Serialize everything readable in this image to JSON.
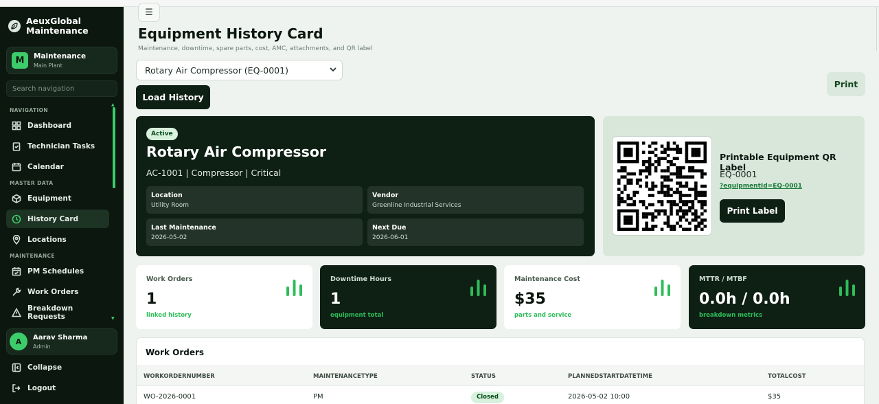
{
  "app": {
    "brand_line1": "AeuxGlobal",
    "brand_line2": "Maintenance",
    "brand_logo_icon": "leaf-icon"
  },
  "workspace": {
    "badge": "M",
    "title": "Maintenance",
    "subtitle": "Main Plant"
  },
  "search": {
    "placeholder": "Search navigation"
  },
  "nav": {
    "section_navigation": "NAVIGATION",
    "section_master": "MASTER DATA",
    "section_maintenance": "MAINTENANCE",
    "items": [
      {
        "label": "Dashboard",
        "icon": "grid-icon"
      },
      {
        "label": "Technician Tasks",
        "icon": "clipboard-icon"
      },
      {
        "label": "Calendar",
        "icon": "calendar-icon"
      },
      {
        "label": "Equipment",
        "icon": "box-icon"
      },
      {
        "label": "History Card",
        "icon": "history-icon"
      },
      {
        "label": "Locations",
        "icon": "pin-icon"
      },
      {
        "label": "PM Schedules",
        "icon": "calendar-check-icon"
      },
      {
        "label": "Work Orders",
        "icon": "wrench-icon"
      },
      {
        "label": "Breakdown Requests",
        "icon": "alert-icon"
      }
    ]
  },
  "user": {
    "initial": "A",
    "name": "Aarav Sharma",
    "role": "Admin"
  },
  "sidebar_bottom": {
    "collapse": "Collapse",
    "logout": "Logout"
  },
  "header": {
    "menu_icon": "☰",
    "title": "Equipment History Card",
    "subtitle": "Maintenance, downtime, spare parts, cost, AMC, attachments, and QR label",
    "print": "Print"
  },
  "selector": {
    "selected": "Rotary Air Compressor (EQ-0001)"
  },
  "load_button": "Load History",
  "equipment": {
    "status": "Active",
    "name": "Rotary Air Compressor",
    "meta": "AC-1001 | Compressor | Critical",
    "location_label": "Location",
    "location": "Utility Room",
    "vendor_label": "Vendor",
    "vendor": "Greenline Industrial Services",
    "last_label": "Last Maintenance",
    "last": "2026-05-02",
    "next_label": "Next Due",
    "next": "2026-06-01"
  },
  "qr": {
    "title": "Printable Equipment QR Label",
    "code": "EQ-0001",
    "link": "?equipmentId=EQ-0001",
    "print": "Print Label"
  },
  "kpis": [
    {
      "label": "Work Orders",
      "value": "1",
      "sub": "linked history",
      "icon": "bar-chart-icon"
    },
    {
      "label": "Downtime Hours",
      "value": "1",
      "sub": "equipment total",
      "icon": "bar-chart-icon"
    },
    {
      "label": "Maintenance Cost",
      "value": "$35",
      "sub": "parts and service",
      "icon": "bar-chart-icon"
    },
    {
      "label": "MTTR / MTBF",
      "value": "0.0h / 0.0h",
      "sub": "breakdown metrics",
      "icon": "bar-chart-icon"
    }
  ],
  "work_orders": {
    "title": "Work Orders",
    "columns": [
      "WORKORDERNUMBER",
      "MAINTENANCETYPE",
      "STATUS",
      "PLANNEDSTARTDATETIME",
      "TOTALCOST"
    ],
    "rows": [
      {
        "number": "WO-2026-0001",
        "type": "PM",
        "status": "Closed",
        "planned": "2026-05-02 10:00",
        "cost": "$35"
      }
    ]
  },
  "colors": {
    "accent": "#3ccd6a",
    "dark": "#0e1f14",
    "sidebar": "#0b170f",
    "qr_panel": "#d8e7d9"
  }
}
